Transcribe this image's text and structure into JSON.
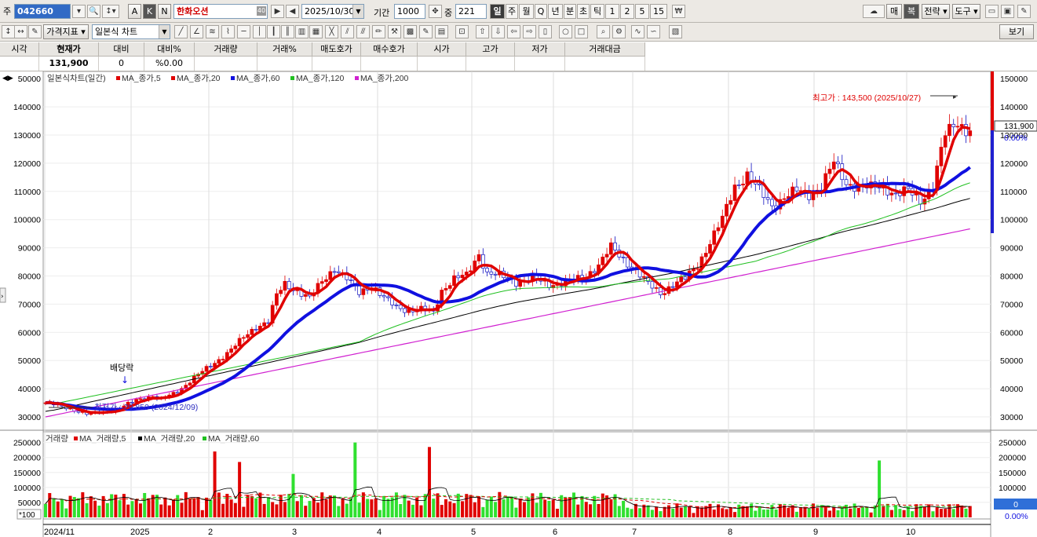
{
  "toolbar1": {
    "prefix": "주",
    "stock_code": "042660",
    "stock_name": "한화오션",
    "date": "2025/10/30",
    "period_label": "기간",
    "period_value": "1000",
    "interval_label": "중",
    "interval_value": "221",
    "btn_a": "A",
    "btn_k": "K",
    "btn_n": "N",
    "name_badge": "40",
    "periods": [
      "일",
      "주",
      "월",
      "Q",
      "년",
      "분",
      "초",
      "틱",
      "1",
      "2",
      "5",
      "15"
    ],
    "right_buttons": [
      "매",
      "복",
      "전략",
      "도구"
    ]
  },
  "toolbar2": {
    "indicator_btn": "가격지표",
    "chart_type": "일본식 차트",
    "view_btn": "보기"
  },
  "quote": {
    "headers": [
      "시각",
      "현재가",
      "대비",
      "대비%",
      "거래량",
      "거래%",
      "매도호가",
      "매수호가",
      "시가",
      "고가",
      "저가",
      "거래대금"
    ],
    "values": [
      "",
      "131,900",
      "0",
      "%0.00",
      "",
      "",
      "",
      "",
      "",
      "",
      "",
      ""
    ]
  },
  "chart": {
    "legend_title": "일본식차트(일간)",
    "ma_legends": [
      {
        "label": "MA_종가,5",
        "color": "#e00000"
      },
      {
        "label": "MA_종가,20",
        "color": "#e00000"
      },
      {
        "label": "MA_종가,60",
        "color": "#1010e0"
      },
      {
        "label": "MA_종가,120",
        "color": "#20c020"
      },
      {
        "label": "MA_종가,200",
        "color": "#d020d0"
      }
    ],
    "price_ticks": [
      "150000",
      "140000",
      "130000",
      "120000",
      "110000",
      "100000",
      "90000",
      "80000",
      "70000",
      "60000",
      "50000",
      "40000",
      "30000"
    ],
    "price_ticks_left": [
      "50000",
      "140000",
      "130000",
      "120000",
      "110000",
      "100000",
      "90000",
      "80000",
      "70000",
      "60000",
      "50000",
      "40000",
      "30000"
    ],
    "current_price": "131,900",
    "current_pct": "0.00%",
    "high_annotation": "최고가 : 143,500 (2025/10/27)",
    "low_annotation": "최저가 : 29,850 (2024/12/09)",
    "dividend_label": "배당락",
    "volume_legend_title": "거래량",
    "volume_legends": [
      {
        "label": "MA_거래량,5",
        "color": "#e00000"
      },
      {
        "label": "MA_거래량,20",
        "color": "#000000"
      },
      {
        "label": "MA_거래량,60",
        "color": "#20c020"
      }
    ],
    "volume_ticks": [
      "250000",
      "200000",
      "150000",
      "100000",
      "50000"
    ],
    "volume_unit": "*100",
    "volume_current": "0",
    "volume_pct": "0.00%",
    "x_labels": [
      "2024/11",
      "2025",
      "2",
      "3",
      "4",
      "5",
      "6",
      "7",
      "8",
      "9",
      "10"
    ]
  },
  "chart_data": {
    "type": "candlestick",
    "price_range": [
      25000,
      152000
    ],
    "volume_range": [
      0,
      270000
    ],
    "events": [
      {
        "label": "최고가",
        "value": 143500,
        "date": "2025/10/27"
      },
      {
        "label": "최저가",
        "value": 29850,
        "date": "2024/12/09"
      }
    ],
    "close_path": [
      [
        0,
        35000
      ],
      [
        6,
        33000
      ],
      [
        10,
        31000
      ],
      [
        15,
        32000
      ],
      [
        18,
        33000
      ],
      [
        22,
        36000
      ],
      [
        26,
        37500
      ],
      [
        28,
        36000
      ],
      [
        32,
        39000
      ],
      [
        36,
        44000
      ],
      [
        40,
        48000
      ],
      [
        45,
        54000
      ],
      [
        48,
        58000
      ],
      [
        51,
        62000
      ],
      [
        54,
        64000
      ],
      [
        56,
        73000
      ],
      [
        58,
        77000
      ],
      [
        61,
        75000
      ],
      [
        64,
        72000
      ],
      [
        67,
        78000
      ],
      [
        70,
        83000
      ],
      [
        73,
        79000
      ],
      [
        76,
        74000
      ],
      [
        79,
        77000
      ],
      [
        82,
        72000
      ],
      [
        85,
        69000
      ],
      [
        88,
        68000
      ],
      [
        91,
        68000
      ],
      [
        94,
        67000
      ],
      [
        96,
        75000
      ],
      [
        99,
        79000
      ],
      [
        102,
        80000
      ],
      [
        105,
        88000
      ],
      [
        107,
        81000
      ],
      [
        110,
        80000
      ],
      [
        114,
        78000
      ],
      [
        118,
        79000
      ],
      [
        122,
        77000
      ],
      [
        126,
        78000
      ],
      [
        130,
        79000
      ],
      [
        134,
        84000
      ],
      [
        137,
        90000
      ],
      [
        140,
        86000
      ],
      [
        143,
        82000
      ],
      [
        146,
        77000
      ],
      [
        149,
        74000
      ],
      [
        152,
        77000
      ],
      [
        155,
        79000
      ],
      [
        158,
        84000
      ],
      [
        161,
        92000
      ],
      [
        164,
        100000
      ],
      [
        167,
        112000
      ],
      [
        170,
        116000
      ],
      [
        173,
        110000
      ],
      [
        176,
        105000
      ],
      [
        179,
        108000
      ],
      [
        182,
        110000
      ],
      [
        185,
        109000
      ],
      [
        188,
        112000
      ],
      [
        191,
        120000
      ],
      [
        194,
        113000
      ],
      [
        197,
        112000
      ],
      [
        200,
        111000
      ],
      [
        203,
        112000
      ],
      [
        206,
        109000
      ],
      [
        209,
        110000
      ],
      [
        212,
        107000
      ],
      [
        215,
        112000
      ],
      [
        218,
        130000
      ],
      [
        221,
        135000
      ],
      [
        223,
        132000
      ],
      [
        224,
        131900
      ]
    ],
    "volume_spikes": [
      {
        "i": 41,
        "v": 220000
      },
      {
        "i": 47,
        "v": 185000
      },
      {
        "i": 60,
        "v": 145000
      },
      {
        "i": 75,
        "v": 250000
      },
      {
        "i": 93,
        "v": 235000
      },
      {
        "i": 202,
        "v": 190000
      }
    ],
    "series": [
      {
        "name": "MA_종가,5",
        "color": "#e00000"
      },
      {
        "name": "MA_종가,20",
        "color": "#e00000"
      },
      {
        "name": "MA_종가,60",
        "color": "#1010e0"
      },
      {
        "name": "MA_종가,120",
        "color": "#20c020"
      },
      {
        "name": "MA_종가,200",
        "color": "#d020d0"
      }
    ]
  }
}
